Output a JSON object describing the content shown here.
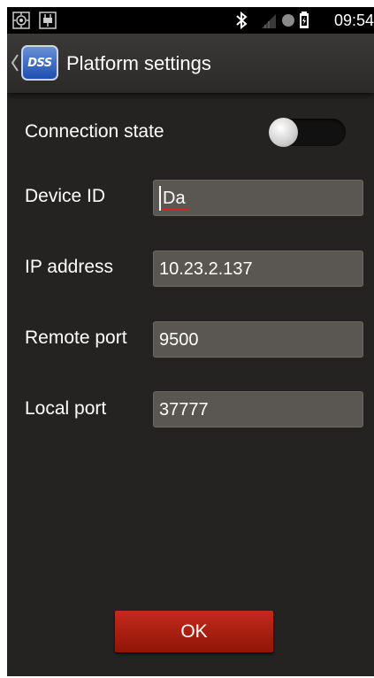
{
  "status_bar": {
    "time": "09:54",
    "left_icons": [
      "gps-icon",
      "usb-debug-icon"
    ],
    "right_icons": [
      "bluetooth-icon",
      "signal-icon",
      "record-icon",
      "battery-icon"
    ]
  },
  "action_bar": {
    "title": "Platform settings",
    "logo_text": "DSS"
  },
  "form": {
    "connection_state": {
      "label": "Connection state",
      "toggle_on": false
    },
    "device_id": {
      "label": "Device ID",
      "value": "Da",
      "misspelled": true
    },
    "ip_address": {
      "label": "IP address",
      "value": "10.23.2.137"
    },
    "remote_port": {
      "label": "Remote port",
      "value": "9500"
    },
    "local_port": {
      "label": "Local port",
      "value": "37777"
    }
  },
  "ok_button": {
    "label": "OK",
    "color": "#b1200f"
  },
  "colors": {
    "background": "#242322",
    "field_background": "#5a5752",
    "status_bar": "#000000",
    "spellcheck_underline": "#e02020"
  }
}
